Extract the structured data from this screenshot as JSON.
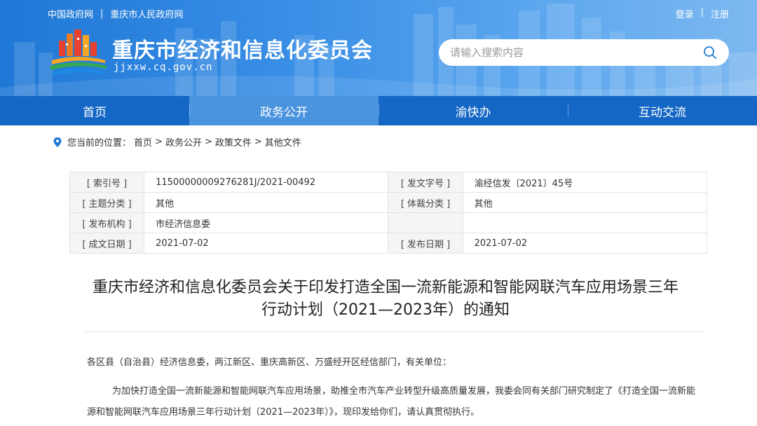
{
  "header": {
    "top_links": [
      "中国政府网",
      "重庆市人民政府网"
    ],
    "user_links": [
      "登录",
      "注册"
    ],
    "title": "重庆市经济和信息化委员会",
    "domain": "jjxxw.cq.gov.cn",
    "search_placeholder": "请输入搜索内容"
  },
  "nav": {
    "items": [
      "首页",
      "政务公开",
      "渝快办",
      "互动交流"
    ],
    "active_index": 1
  },
  "breadcrumb": {
    "label": "您当前的位置：",
    "items": [
      "首页",
      "政务公开",
      "政策文件",
      "其他文件"
    ],
    "separator": ">"
  },
  "info": {
    "index_no_label": "[ 索引号 ]",
    "index_no": "11500000009276281J/2021-00492",
    "doc_no_label": "[ 发文字号 ]",
    "doc_no": "渝经信发〔2021〕45号",
    "topic_label": "[ 主题分类 ]",
    "topic": "其他",
    "genre_label": "[ 体裁分类 ]",
    "genre": "其他",
    "publisher_label": "[ 发布机构 ]",
    "publisher": "市经济信息委",
    "created_label": "[ 成文日期 ]",
    "created": "2021-07-02",
    "published_label": "[ 发布日期 ]",
    "published": "2021-07-02"
  },
  "document": {
    "title_line1": "重庆市经济和信息化委员会关于印发打造全国一流新能源和智能网联汽车应用场景三年",
    "title_line2": "行动计划（2021—2023年）的通知",
    "para1": "各区县（自治县）经济信息委，两江新区、重庆高新区、万盛经开区经信部门，有关单位：",
    "para2": "为加快打造全国一流新能源和智能网联汽车应用场景，助推全市汽车产业转型升级高质量发展，我委会同有关部门研究制定了《打造全国一流新能源和智能网联汽车应用场景三年行动计划（2021—2023年）》，现印发给你们，请认真贯彻执行。"
  },
  "colors": {
    "header_blue": "#1f78d6",
    "nav_blue": "#1467c4",
    "nav_active": "#4a94df"
  }
}
